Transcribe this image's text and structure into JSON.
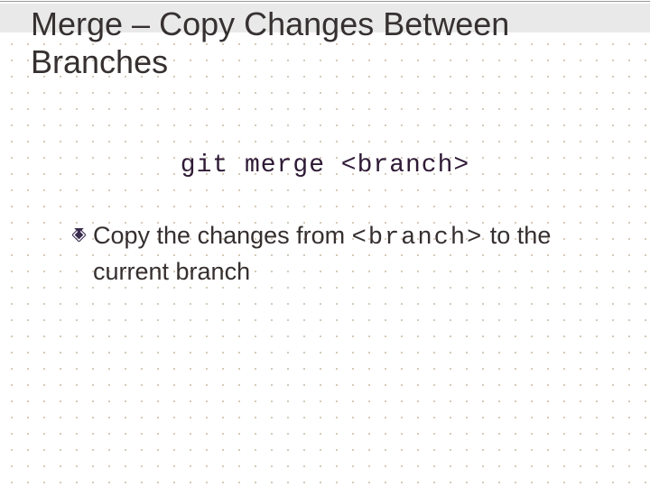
{
  "title": "Merge – Copy Changes Between Branches",
  "command": "git merge <branch>",
  "bullet": {
    "pre": "Copy the changes from ",
    "code": "<branch>",
    "post": " to the current branch"
  }
}
